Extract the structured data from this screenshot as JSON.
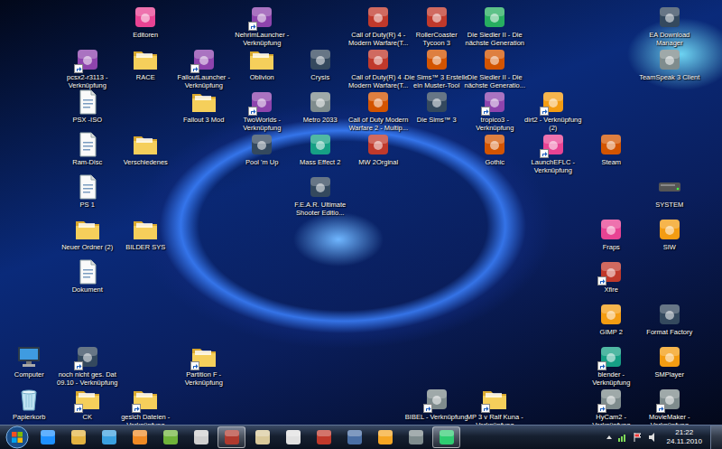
{
  "desktop": {
    "icons": [
      {
        "label": [
          "Editoren"
        ],
        "kind": "app",
        "shortcut": false,
        "selected": false
      },
      {
        "label": [
          "NehrimLauncher -",
          "Verknüpfung"
        ],
        "kind": "app",
        "shortcut": true,
        "selected": false
      },
      {
        "label": [
          "Call of Duty(R) 4 -",
          "Modern Warfare(T..."
        ],
        "kind": "app",
        "shortcut": false,
        "selected": false
      },
      {
        "label": [
          "RollerCoaster",
          "Tycoon 3"
        ],
        "kind": "app",
        "shortcut": false,
        "selected": false
      },
      {
        "label": [
          "Die Siedler II - Die",
          "nächste Generation"
        ],
        "kind": "app",
        "shortcut": false,
        "selected": false
      },
      {
        "label": [
          "EA Download",
          "Manager"
        ],
        "kind": "app",
        "shortcut": false,
        "selected": false
      },
      {
        "label": [
          "pcsx2-r3113 -",
          "Verknüpfung"
        ],
        "kind": "app",
        "shortcut": true,
        "selected": false
      },
      {
        "label": [
          "RACE"
        ],
        "kind": "folder",
        "shortcut": false,
        "selected": false
      },
      {
        "label": [
          "FalloutLauncher -",
          "Verknüpfung"
        ],
        "kind": "app",
        "shortcut": true,
        "selected": false
      },
      {
        "label": [
          "Oblivion"
        ],
        "kind": "folder",
        "shortcut": false,
        "selected": false
      },
      {
        "label": [
          "Crysis"
        ],
        "kind": "app",
        "shortcut": false,
        "selected": false
      },
      {
        "label": [
          "Call of Duty(R) 4 -",
          "Modern Warfare(T..."
        ],
        "kind": "app",
        "shortcut": false,
        "selected": false
      },
      {
        "label": [
          "Die Sims™ 3 Erstelle",
          "ein Muster-Tool"
        ],
        "kind": "app",
        "shortcut": false,
        "selected": false
      },
      {
        "label": [
          "Die Siedler II - Die",
          "nächste Generatio..."
        ],
        "kind": "app",
        "shortcut": false,
        "selected": false
      },
      {
        "label": [
          "TeamSpeak 3 Client"
        ],
        "kind": "app",
        "shortcut": false,
        "selected": false
      },
      {
        "label": [
          "PSX -ISO"
        ],
        "kind": "document",
        "shortcut": false,
        "selected": false
      },
      {
        "label": [
          "Fallout 3 Mod"
        ],
        "kind": "folder",
        "shortcut": false,
        "selected": false
      },
      {
        "label": [
          "TwoWorlds -",
          "Verknüpfung"
        ],
        "kind": "app",
        "shortcut": true,
        "selected": false
      },
      {
        "label": [
          "Metro 2033"
        ],
        "kind": "app",
        "shortcut": false,
        "selected": false
      },
      {
        "label": [
          "Call of Duty Modern",
          "Warfare 2 - Multip..."
        ],
        "kind": "app",
        "shortcut": false,
        "selected": false
      },
      {
        "label": [
          "Die Sims™ 3"
        ],
        "kind": "app",
        "shortcut": false,
        "selected": false
      },
      {
        "label": [
          "tropico3 -",
          "Verknüpfung"
        ],
        "kind": "app",
        "shortcut": true,
        "selected": false
      },
      {
        "label": [
          "dirt2 - Verknüpfung",
          "(2)"
        ],
        "kind": "app",
        "shortcut": true,
        "selected": false
      },
      {
        "label": [
          "Ram-Disc"
        ],
        "kind": "document",
        "shortcut": false,
        "selected": false
      },
      {
        "label": [
          "Verschiedenes"
        ],
        "kind": "folder",
        "shortcut": false,
        "selected": false
      },
      {
        "label": [
          "Pool 'm Up"
        ],
        "kind": "app",
        "shortcut": false,
        "selected": false
      },
      {
        "label": [
          "Mass Effect 2"
        ],
        "kind": "app",
        "shortcut": false,
        "selected": false
      },
      {
        "label": [
          "MW 2Orginal"
        ],
        "kind": "app",
        "shortcut": false,
        "selected": false
      },
      {
        "label": [
          "Gothic"
        ],
        "kind": "app",
        "shortcut": false,
        "selected": false
      },
      {
        "label": [
          "LaunchEFLC -",
          "Verknüpfung"
        ],
        "kind": "app",
        "shortcut": true,
        "selected": false
      },
      {
        "label": [
          "Steam"
        ],
        "kind": "app",
        "shortcut": false,
        "selected": false
      },
      {
        "label": [
          "PS 1"
        ],
        "kind": "document",
        "shortcut": false,
        "selected": false
      },
      {
        "label": [
          "F.E.A.R. Ultimate",
          "Shooter Editio..."
        ],
        "kind": "app",
        "shortcut": false,
        "selected": false
      },
      {
        "label": [
          "SYSTEM"
        ],
        "kind": "drive",
        "shortcut": false,
        "selected": false
      },
      {
        "label": [
          "Neuer Ordner (2)"
        ],
        "kind": "folder",
        "shortcut": false,
        "selected": false
      },
      {
        "label": [
          "BILDER SYS"
        ],
        "kind": "folder",
        "shortcut": false,
        "selected": false
      },
      {
        "label": [
          "Fraps"
        ],
        "kind": "app",
        "shortcut": false,
        "selected": false
      },
      {
        "label": [
          "SIW"
        ],
        "kind": "app",
        "shortcut": false,
        "selected": false
      },
      {
        "label": [
          "Dokument"
        ],
        "kind": "document",
        "shortcut": false,
        "selected": false
      },
      {
        "label": [
          "Xfire"
        ],
        "kind": "app",
        "shortcut": true,
        "selected": false
      },
      {
        "label": [
          "GIMP 2"
        ],
        "kind": "app",
        "shortcut": false,
        "selected": false
      },
      {
        "label": [
          "Format Factory"
        ],
        "kind": "app",
        "shortcut": false,
        "selected": false
      },
      {
        "label": [
          "Computer"
        ],
        "kind": "computer",
        "shortcut": false,
        "selected": false
      },
      {
        "label": [
          "noch nicht ges. Dat",
          "09.10 - Verknüpfung"
        ],
        "kind": "app",
        "shortcut": true,
        "selected": false
      },
      {
        "label": [
          "Partition F -",
          "Verknüpfung"
        ],
        "kind": "folder",
        "shortcut": true,
        "selected": false
      },
      {
        "label": [
          "blender -",
          "Verknüpfung"
        ],
        "kind": "app",
        "shortcut": true,
        "selected": false
      },
      {
        "label": [
          "SMPlayer"
        ],
        "kind": "app",
        "shortcut": false,
        "selected": false
      },
      {
        "label": [
          "Papierkorb"
        ],
        "kind": "recycle",
        "shortcut": false,
        "selected": false
      },
      {
        "label": [
          "CK"
        ],
        "kind": "folder",
        "shortcut": true,
        "selected": false
      },
      {
        "label": [
          "gesich Dateien -",
          "Verknüpfung"
        ],
        "kind": "folder",
        "shortcut": true,
        "selected": false
      },
      {
        "label": [
          "BIBEL - Verknüpfung"
        ],
        "kind": "app",
        "shortcut": true,
        "selected": false
      },
      {
        "label": [
          "MP 3 v Ralf Kuna -",
          "Verknüpfung"
        ],
        "kind": "folder",
        "shortcut": true,
        "selected": false
      },
      {
        "label": [
          "HyCam2 -",
          "Verknüpfung"
        ],
        "kind": "app",
        "shortcut": true,
        "selected": false
      },
      {
        "label": [
          "MovieMaker -",
          "Verknüpfung"
        ],
        "kind": "app",
        "shortcut": true,
        "selected": false
      }
    ]
  },
  "taskbar": {
    "buttons": [
      {
        "selected": false
      },
      {
        "selected": false
      },
      {
        "selected": false
      },
      {
        "selected": false
      },
      {
        "selected": false
      },
      {
        "selected": false
      },
      {
        "selected": true
      },
      {
        "selected": false
      },
      {
        "selected": false
      },
      {
        "selected": false
      },
      {
        "selected": false
      },
      {
        "selected": false
      },
      {
        "selected": false
      },
      {
        "selected": true
      }
    ],
    "clock": {
      "time": "21:22",
      "date": "24.11.2010"
    }
  }
}
